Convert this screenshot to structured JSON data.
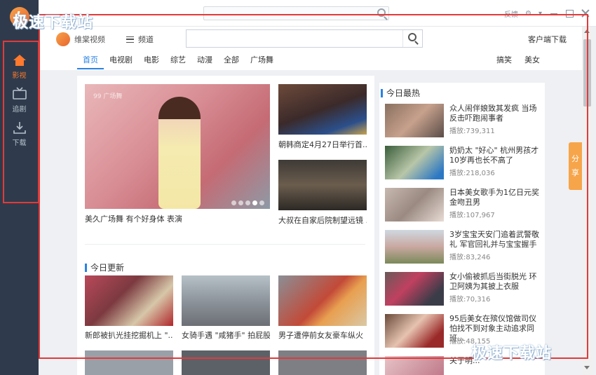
{
  "window": {
    "controls": [
      "反馈",
      "⚙",
      "▾"
    ]
  },
  "sidebar": {
    "items": [
      {
        "label": "影视",
        "icon": "home-icon",
        "active": true
      },
      {
        "label": "追剧",
        "icon": "tv-icon",
        "active": false
      },
      {
        "label": "下载",
        "icon": "download-icon",
        "active": false
      }
    ]
  },
  "header": {
    "brand": "维棠视频",
    "channel": "频道",
    "search_placeholder": "",
    "client_download": "客户端下载"
  },
  "nav": {
    "tabs": [
      "首页",
      "电视剧",
      "电影",
      "综艺",
      "动漫",
      "全部",
      "广场舞"
    ],
    "active_tab": "首页",
    "right": [
      "搞笑",
      "美女"
    ]
  },
  "featured": {
    "hero_caption": "美久广场舞 有个好身体 表演",
    "hero_watermark": "99 广场舞",
    "side": [
      {
        "caption": "朝韩商定4月27日举行首..."
      },
      {
        "caption": "大叔在自家后院制望远镜 ..."
      }
    ]
  },
  "today_update": {
    "title": "今日更新",
    "items": [
      {
        "caption": "新郎被扒光挂挖掘机上 \"..."
      },
      {
        "caption": "女骑手遇 \"咸猪手\" 拍屁股"
      },
      {
        "caption": "男子遭停前女友豪车纵火"
      }
    ]
  },
  "today_hot": {
    "title": "今日最热",
    "items": [
      {
        "title": "众人闹伴娘致其发疯 当场反击吓跑闹事者",
        "plays": "播放:739,311"
      },
      {
        "title": "奶奶太 \"好心\" 杭州男孩才10岁再也长不高了",
        "plays": "播放:218,036"
      },
      {
        "title": "日本美女歌手为1亿日元奖金吻丑男",
        "plays": "播放:107,967"
      },
      {
        "title": "3岁宝宝天安门追着武警敬礼 军官回礼并与宝宝握手",
        "plays": "播放:83,246"
      },
      {
        "title": "女小偷被抓后当街脱光 环卫阿姨为其披上衣服",
        "plays": "播放:70,316"
      },
      {
        "title": "95后美女在殡仪馆做司仪 怕找不到对象主动追求同班...",
        "plays": "播放:48,155"
      },
      {
        "title": "关于明...",
        "plays": ""
      }
    ]
  },
  "share": "分享",
  "watermark": "极速下载站",
  "colors": {
    "accent": "#2a82e4",
    "sidebar": "#2f3b4c",
    "active": "#ff7a2e",
    "share": "#f7a54a",
    "annotation": "#e23a3a"
  }
}
